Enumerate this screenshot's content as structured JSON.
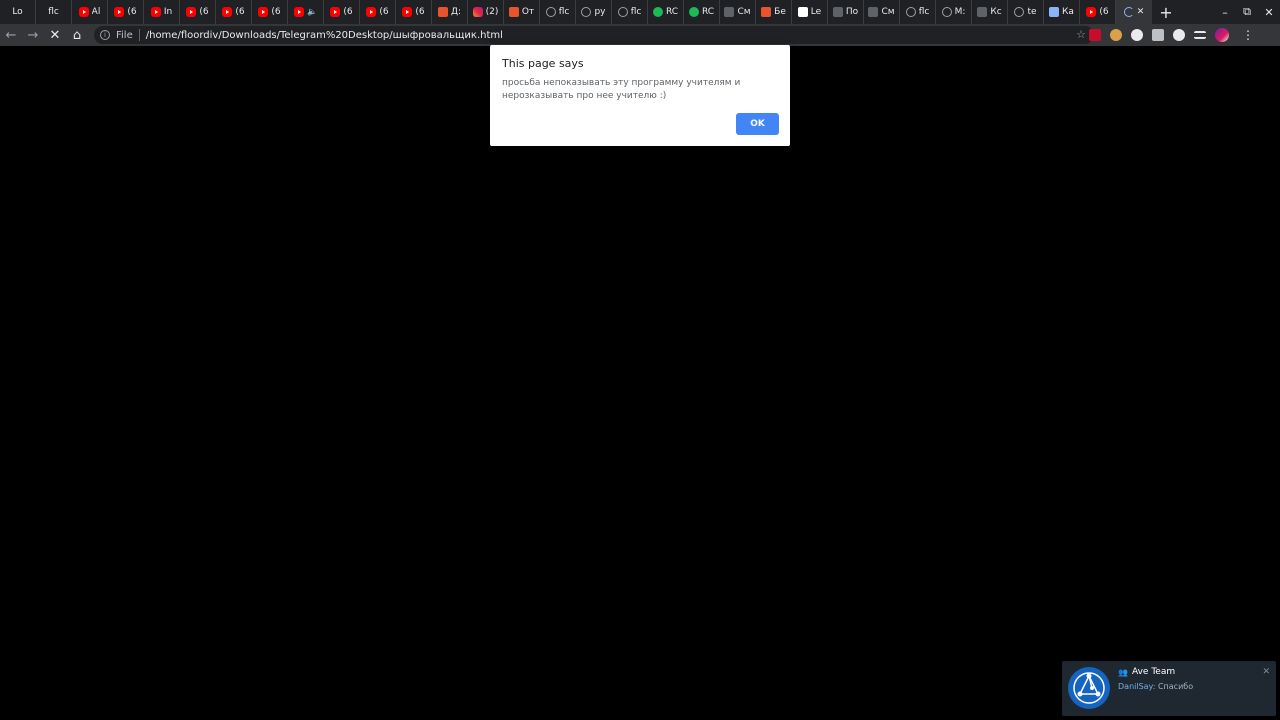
{
  "tabs": [
    {
      "title": "Lo",
      "icon": "none"
    },
    {
      "title": "flc",
      "icon": "none"
    },
    {
      "title": "Al",
      "icon": "yt"
    },
    {
      "title": "(6",
      "icon": "yt"
    },
    {
      "title": "In",
      "icon": "yt"
    },
    {
      "title": "(6",
      "icon": "yt"
    },
    {
      "title": "(6",
      "icon": "yt"
    },
    {
      "title": "(6",
      "icon": "yt"
    },
    {
      "title": "",
      "icon": "yt-speaker"
    },
    {
      "title": "(6",
      "icon": "yt"
    },
    {
      "title": "(6",
      "icon": "yt"
    },
    {
      "title": "(6",
      "icon": "yt"
    },
    {
      "title": "Д:",
      "icon": "ora"
    },
    {
      "title": "(2)",
      "icon": "insta"
    },
    {
      "title": "От",
      "icon": "ora"
    },
    {
      "title": "flc",
      "icon": "gh"
    },
    {
      "title": "ру",
      "icon": "gh"
    },
    {
      "title": "flc",
      "icon": "gh"
    },
    {
      "title": "RC",
      "icon": "green"
    },
    {
      "title": "RC",
      "icon": "green"
    },
    {
      "title": "См",
      "icon": "gray"
    },
    {
      "title": "Бе",
      "icon": "ora"
    },
    {
      "title": "Le",
      "icon": "white"
    },
    {
      "title": "По",
      "icon": "gray"
    },
    {
      "title": "См",
      "icon": "gray"
    },
    {
      "title": "flc",
      "icon": "gh"
    },
    {
      "title": "M:",
      "icon": "gh"
    },
    {
      "title": "Кс",
      "icon": "gray"
    },
    {
      "title": "te",
      "icon": "gh"
    },
    {
      "title": "Ка",
      "icon": "blue"
    },
    {
      "title": "(6",
      "icon": "yt"
    }
  ],
  "active_tab": {
    "icon": "spinner",
    "close": "✕"
  },
  "new_tab": "+",
  "window_controls": {
    "minimize": "–",
    "maximize": "⧉",
    "close": "✕"
  },
  "toolbar": {
    "back": "←",
    "forward": "→",
    "stop": "✕",
    "home": "⌂",
    "scheme": "File",
    "url": "/home/floordiv/Downloads/Telegram%20Desktop/шыфровальщик.html",
    "star": "☆",
    "menu": "⋮"
  },
  "dialog": {
    "title": "This page says",
    "message": "просьба непоказывать эту программу учителям и нерозказывать про нее учителю :)",
    "ok_label": "OK"
  },
  "notification": {
    "title": "Ave Team",
    "sender": "DanilSay:",
    "text": "Спасибо",
    "close": "✕"
  }
}
